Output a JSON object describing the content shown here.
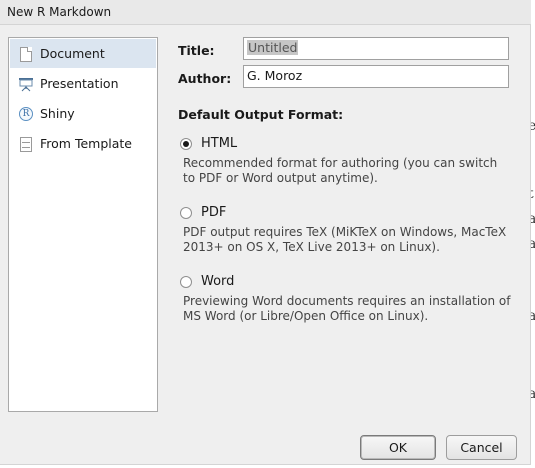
{
  "window": {
    "title": "New R Markdown"
  },
  "sidebar": {
    "items": [
      {
        "label": "Document",
        "icon": "document-icon",
        "selected": true
      },
      {
        "label": "Presentation",
        "icon": "presentation-icon",
        "selected": false
      },
      {
        "label": "Shiny",
        "icon": "shiny-icon",
        "selected": false
      },
      {
        "label": "From Template",
        "icon": "template-icon",
        "selected": false
      }
    ]
  },
  "form": {
    "title_label": "Title:",
    "title_value": "Untitled",
    "author_label": "Author:",
    "author_value": "G. Moroz"
  },
  "output": {
    "heading": "Default Output Format:",
    "selected": "HTML",
    "options": [
      {
        "label": "HTML",
        "description": "Recommended format for authoring (you can switch to PDF or Word output anytime)."
      },
      {
        "label": "PDF",
        "description": "PDF output requires TeX (MiKTeX on Windows, MacTeX 2013+ on OS X, TeX Live 2013+ on Linux)."
      },
      {
        "label": "Word",
        "description": "Previewing Word documents requires an installation of MS Word (or Libre/Open Office on Linux)."
      }
    ]
  },
  "buttons": {
    "ok": "OK",
    "cancel": "Cancel"
  },
  "background_glyphs": [
    "e",
    "t",
    "a",
    "a",
    "a",
    "a"
  ]
}
